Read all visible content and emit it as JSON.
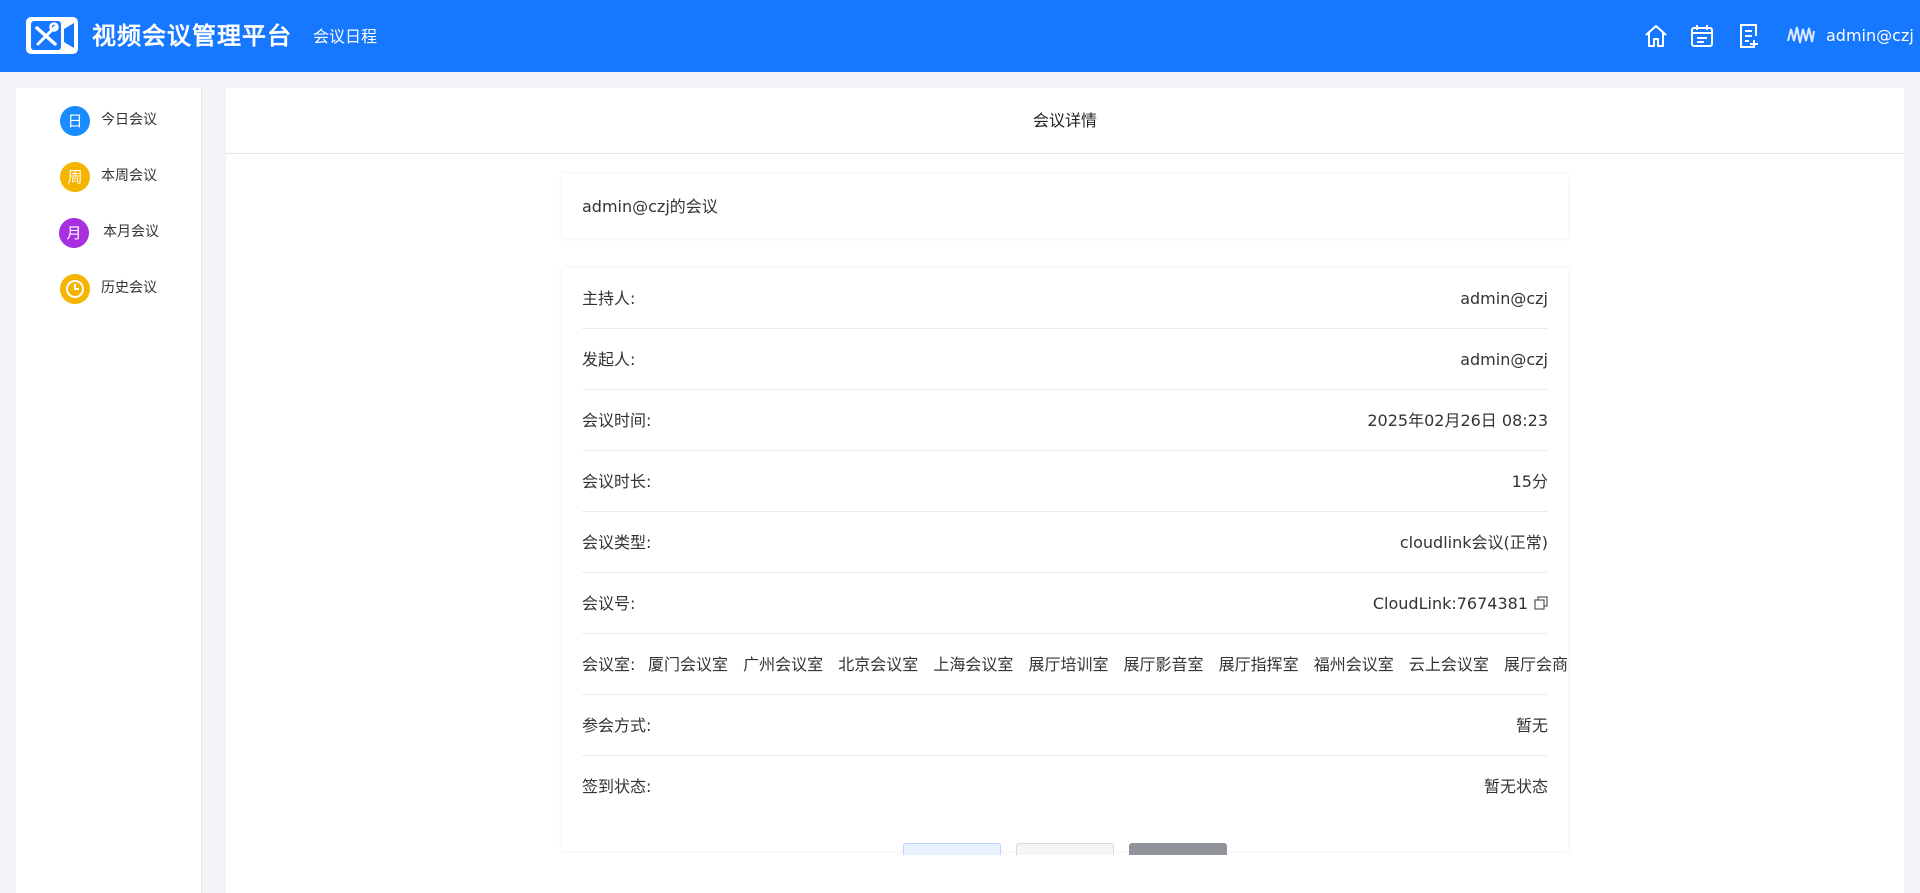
{
  "header": {
    "app_title": "视频会议管理平台",
    "nav_link": "会议日程",
    "username": "admin@czj",
    "icons": [
      "home-icon",
      "calendar-icon",
      "note-add-icon"
    ],
    "brand_color": "#1677ff"
  },
  "sidebar": {
    "items": [
      {
        "badge": "日",
        "label": "今日会议",
        "color": "#1a8cff"
      },
      {
        "badge": "周",
        "label": "本周会议",
        "color": "#f5b400"
      },
      {
        "badge": "月",
        "label": "本月会议",
        "color": "#a72fe0"
      },
      {
        "badge": "",
        "icon": "clock-icon",
        "label": "历史会议",
        "color": "#f5b400"
      }
    ]
  },
  "main": {
    "title": "会议详情",
    "meeting_title": "admin@czj的会议",
    "details": [
      {
        "label": "主持人:",
        "value": "admin@czj"
      },
      {
        "label": "发起人:",
        "value": "admin@czj"
      },
      {
        "label": "会议时间:",
        "value": "2025年02月26日 08:23"
      },
      {
        "label": "会议时长:",
        "value": "15分"
      },
      {
        "label": "会议类型:",
        "value": "cloudlink会议(正常)"
      },
      {
        "label": "会议号:",
        "value": "CloudLink:7674381"
      },
      {
        "label": "会议室:",
        "rooms": [
          "厦门会议室",
          "广州会议室",
          "北京会议室",
          "上海会议室",
          "展厅培训室",
          "展厅影音室",
          "展厅指挥室",
          "福州会议室",
          "云上会议室",
          "展厅会商室"
        ]
      },
      {
        "label": "参会方式:",
        "value": "暂无"
      },
      {
        "label": "签到状态:",
        "value": "暂无状态"
      }
    ]
  }
}
